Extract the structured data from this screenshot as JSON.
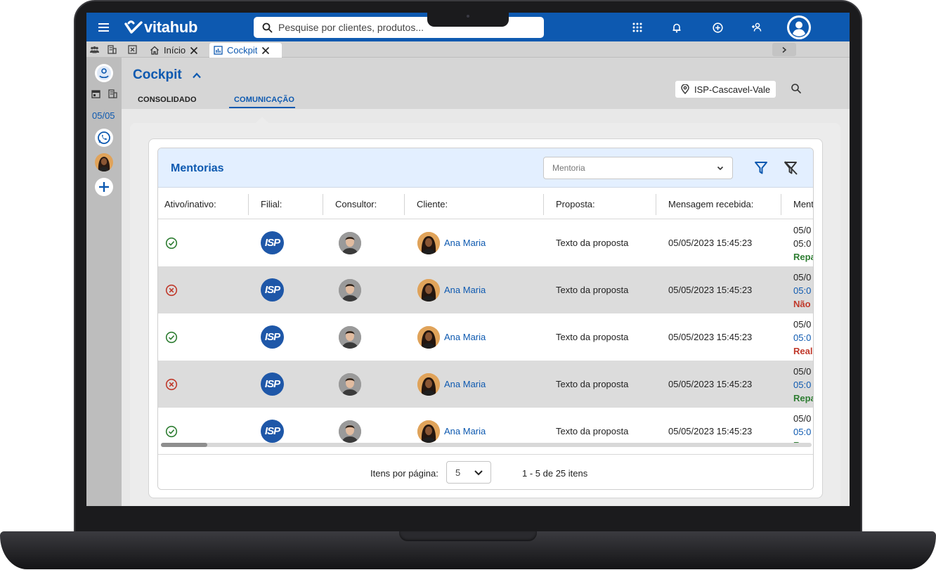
{
  "app": {
    "brand": "vitahub",
    "search_placeholder": "Pesquise por clientes, produtos..."
  },
  "tabs": [
    {
      "label": "Início",
      "icon": "home-icon"
    },
    {
      "label": "Cockpit",
      "icon": "chart-icon"
    }
  ],
  "rail": {
    "date": "05/05"
  },
  "page": {
    "title": "Cockpit",
    "tabs": [
      "CONSOLIDADO",
      "COMUNICAÇÃO"
    ],
    "active_tab": "COMUNICAÇÃO",
    "location": "ISP-Cascavel-Vale"
  },
  "card": {
    "title": "Mentorias",
    "select_value": "Mentoria",
    "columns": [
      "Ativo/inativo:",
      "Filial:",
      "Consultor:",
      "Cliente:",
      "Proposta:",
      "Mensagem recebida:",
      "Ment"
    ],
    "rows": [
      {
        "active": true,
        "filial": "ISP",
        "cliente": "Ana Maria",
        "proposta": "Texto da proposta",
        "mensagem": "05/05/2023 15:45:23",
        "m1": "05/0",
        "m2": "05:0",
        "m3": "Repa",
        "m2_link": false,
        "m3_color": "green"
      },
      {
        "active": false,
        "filial": "ISP",
        "cliente": "Ana Maria",
        "proposta": "Texto da proposta",
        "mensagem": "05/05/2023 15:45:23",
        "m1": "05/0",
        "m2": "05:0",
        "m3": "Não",
        "m2_link": true,
        "m3_color": "red"
      },
      {
        "active": true,
        "filial": "ISP",
        "cliente": "Ana Maria",
        "proposta": "Texto da proposta",
        "mensagem": "05/05/2023 15:45:23",
        "m1": "05/0",
        "m2": "05:0",
        "m3": "Reali",
        "m2_link": true,
        "m3_color": "red"
      },
      {
        "active": false,
        "filial": "ISP",
        "cliente": "Ana Maria",
        "proposta": "Texto da proposta",
        "mensagem": "05/05/2023 15:45:23",
        "m1": "05/0",
        "m2": "05:0",
        "m3": "Repa",
        "m2_link": true,
        "m3_color": "green"
      },
      {
        "active": true,
        "filial": "ISP",
        "cliente": "Ana Maria",
        "proposta": "Texto da proposta",
        "mensagem": "05/05/2023 15:45:23",
        "m1": "05/0",
        "m2": "05:0",
        "m3": "Repa",
        "m2_link": true,
        "m3_color": "green"
      }
    ]
  },
  "pagination": {
    "label": "Itens por página:",
    "per_page": "5",
    "range": "1 - 5 de 25 itens"
  },
  "colors": {
    "brand": "#0d59b0",
    "active_green": "#2e7d32",
    "inactive_red": "#c0392b"
  }
}
